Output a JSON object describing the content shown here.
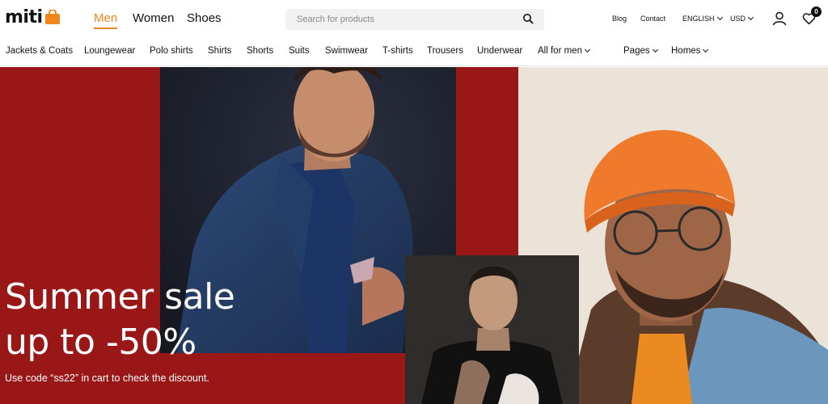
{
  "brand": {
    "name": "miti",
    "accent": "#f0861c"
  },
  "genders": [
    {
      "label": "Men",
      "active": true
    },
    {
      "label": "Women",
      "active": false
    },
    {
      "label": "Shoes",
      "active": false
    }
  ],
  "search": {
    "placeholder": "Search for products",
    "value": "",
    "icon": "search-icon"
  },
  "utility": {
    "blog": "Blog",
    "contact": "Contact",
    "language": "ENGLISH",
    "currency": "USD",
    "cart_count": "0"
  },
  "categories": [
    "Jackets & Coats",
    "Loungewear",
    "Polo shirts",
    "Shirts",
    "Shorts",
    "Suits",
    "Swimwear",
    "T-shirts",
    "Trousers",
    "Underwear",
    "All for men"
  ],
  "menus": {
    "pages": "Pages",
    "homes": "Homes"
  },
  "hero": {
    "line1": "Summer sale",
    "line2": "up to -50%",
    "subtitle": "Use code “ss22” in cart to check the discount.",
    "colors": {
      "red": "#9a1718",
      "beige": "#ebe3d8",
      "orange_beanie": "#f07a2c",
      "denim": "#5f8db3"
    }
  }
}
